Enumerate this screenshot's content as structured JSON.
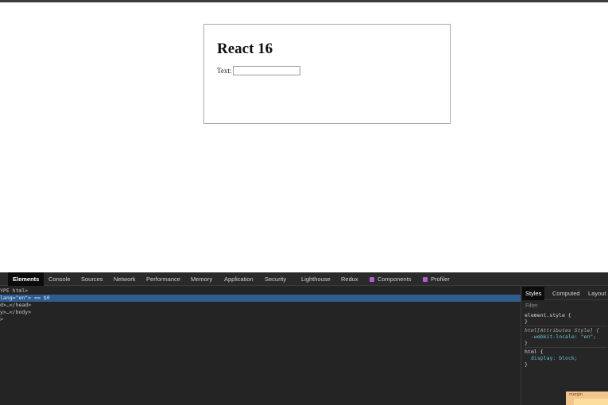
{
  "page": {
    "card": {
      "title": "React 16",
      "text_label": "Text:",
      "text_value": ""
    }
  },
  "devtools": {
    "tabs": [
      {
        "label": "Elements",
        "active": true
      },
      {
        "label": "Console"
      },
      {
        "label": "Sources"
      },
      {
        "label": "Network"
      },
      {
        "label": "Performance"
      },
      {
        "label": "Memory"
      },
      {
        "label": "Application"
      },
      {
        "label": "Security"
      },
      {
        "label": "Lighthouse"
      },
      {
        "label": "Redux"
      },
      {
        "label": "Components",
        "icon": "react-icon"
      },
      {
        "label": "Profiler",
        "icon": "react-icon"
      }
    ],
    "dom_lines": [
      "YPE html>",
      "lang=\"en\"> == $0",
      "d>…</head>",
      "y>…</body>",
      ">"
    ],
    "styles": {
      "tabs": [
        "Styles",
        "Computed",
        "Layout"
      ],
      "filter_placeholder": "Filter",
      "rules": [
        {
          "selector": "element.style {",
          "lines": [
            "}"
          ]
        },
        {
          "selector": "html[Attributes Style] {",
          "lines": [
            "-webkit-locale: \"en\";",
            "}"
          ]
        },
        {
          "selector": "html {",
          "lines": [
            "display: block;",
            "}"
          ]
        }
      ]
    },
    "box_model_label": "margin",
    "accent": "#2f5d90"
  }
}
